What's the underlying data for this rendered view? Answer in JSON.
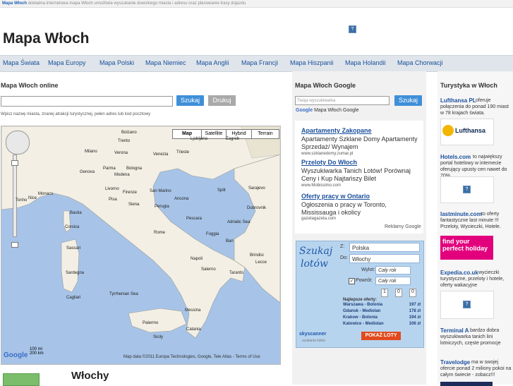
{
  "topbar": {
    "brand": "Mapa Włoch",
    "text": "dokładna internetowa mapa Włoch umożliwia wyszukanie dowolnego miasta i adresu oraz planowanie trasy dojazdu"
  },
  "header": {
    "title": "Mapa Włoch"
  },
  "nav": [
    "Mapa Świata",
    "Mapa Europy",
    "Mapa Polski",
    "Mapa Niemiec",
    "Mapa Anglii",
    "Mapa Francji",
    "Mapa Hiszpanii",
    "Mapa Holandii",
    "Mapa Chorwacji"
  ],
  "left": {
    "heading": "Mapa Włoch online",
    "search_value": "",
    "search_button": "Szukaj",
    "print_button": "Drukuj",
    "hint": "Wpisz nazwę miasta, znanej atrakcji turystycznej, pełen adres lub kod pocztowy",
    "map_types": [
      "Map",
      "Satellite",
      "Hybrid",
      "Terrain"
    ],
    "cities": [
      "Torino",
      "Milano",
      "Verona",
      "Venezia",
      "Genova",
      "Bologna",
      "Firenze",
      "Pisa",
      "Perugia",
      "Rome",
      "Napoli",
      "Bari",
      "Taranto",
      "Cagliari",
      "Palermo",
      "Messina",
      "Sassari",
      "Sardegna",
      "Sicily",
      "Tyrrhenian Sea",
      "Adriatic Sea",
      "Ljubljana",
      "Zagreb",
      "Sarajevo",
      "San Marino",
      "Trieste",
      "Split",
      "Dubrovnik",
      "Monaco",
      "Nice",
      "Bastia",
      "Corsica",
      "Ancona",
      "Pescara",
      "Foggia",
      "Salerno",
      "Catania",
      "Trento",
      "Bolzano",
      "Parma",
      "Modena",
      "Livorno",
      "Siena",
      "Brindisi",
      "Lecce"
    ],
    "map_copyright": "Map data ©2011 Europa Technologies, Google, Tele Atlas - Terms of Use",
    "scale_top": "100 mi",
    "scale_bottom": "200 km",
    "google": "Google",
    "country_title": "Włochy"
  },
  "middle": {
    "heading": "Mapa Włoch Google",
    "search_placeholder": "Twoja wyszukiwarka",
    "search_button": "Szukaj",
    "google_label": "Mapa Włoch Google",
    "ads": [
      {
        "title": "Apartamenty Zakopane",
        "text": "Apartamenty Szklane Domy Apartamenty Sprzedaż/ Wynajem",
        "url": "www.szklanedomy.zumar.pl"
      },
      {
        "title": "Przeloty Do Włoch",
        "text": "Wyszukiwarka Tanich Lotów! Porównaj Ceny i Kup Najtańszy Bilet",
        "url": "www.Mobissimo.com"
      },
      {
        "title": "Oferty pracy w Ontario",
        "text": "Ogłoszenia o pracy w Toronto, Mississauga i okolicy",
        "url": "gazetagazeta.com"
      }
    ],
    "ads_label": "Reklamy Google",
    "flight": {
      "brand_top": "Szukaj",
      "brand_bottom": "lotów",
      "from_label": "Z:",
      "from_value": "Polska",
      "to_label": "Do:",
      "to_value": "Włochy",
      "depart_label": "Wylot:",
      "depart_value": "Cały rok",
      "return_label": "Powrót:",
      "return_value": "Cały rok",
      "counts": [
        "1",
        "0",
        "0"
      ],
      "offers_title": "Najlepsze oferty:",
      "offers": [
        {
          "route": "Warszawa - Bolonia",
          "price": "197 zł"
        },
        {
          "route": "Gdansk - Mediolan",
          "price": "178 zł"
        },
        {
          "route": "Krakow - Bolonia",
          "price": "194 zł"
        },
        {
          "route": "Katowice - Mediolan",
          "price": "106 zł"
        }
      ],
      "skyscanner": "skyscanner",
      "skyscanner_sub": "szukanie lotów",
      "show_button": "POKAŻ LOTY"
    }
  },
  "right": {
    "heading": "Turystyka w Włoch",
    "items": [
      {
        "title": "Lufthansa PL",
        "text": "oferuje połączenia do ponad 190 miast w 78 krajach świata."
      },
      {
        "title": "Hotels.com",
        "text": "to największy portal hotelowy w internecie oferujący upusty cen nawet do 70%"
      },
      {
        "title": "lastminute.com",
        "text": "to oferty fantastyczne last minute !!! Przeloty, Wycieczki, Hotele."
      },
      {
        "title": "Expedia.co.uk",
        "text": "wycieczki turystyczne, przeloty i hotele, oferty wakacyjne"
      },
      {
        "title": "Terminal A",
        "text": "bardzo dobra wyszukiwarka tanich lini lotniczych, częste promocje"
      },
      {
        "title": "Travelodge",
        "text": "ma w swojej ofercie ponad 2 miliony pokoi na całym świecie - zobacz!!!"
      }
    ],
    "lufthansa_logo": "Lufthansa",
    "lastminute_banner": "find your perfect holiday"
  }
}
